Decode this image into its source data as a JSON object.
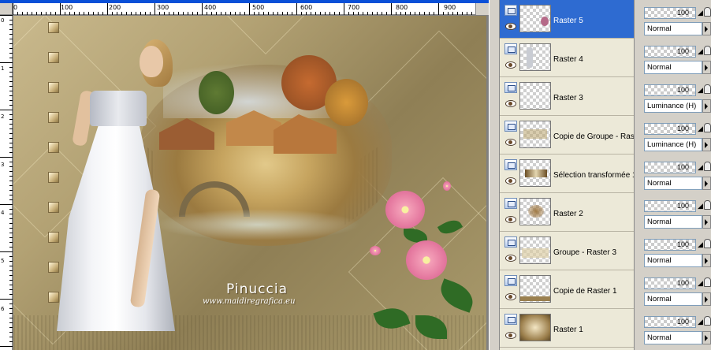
{
  "ruler": {
    "h_labels": [
      "0",
      "100",
      "200",
      "300",
      "400",
      "500",
      "600",
      "700",
      "800",
      "900"
    ],
    "v_labels": [
      "0",
      "1",
      "2",
      "3",
      "4",
      "5",
      "6"
    ]
  },
  "artwork": {
    "signature_name": "Pinuccia",
    "signature_url": "www.maidiregrafica.eu"
  },
  "layers": [
    {
      "name": "Raster 5",
      "selected": true,
      "opacity": "100",
      "blend": "Normal"
    },
    {
      "name": "Raster 4",
      "selected": false,
      "opacity": "100",
      "blend": "Normal"
    },
    {
      "name": "Raster 3",
      "selected": false,
      "opacity": "100",
      "blend": "Luminance (H)"
    },
    {
      "name": "Copie de Groupe - Raste",
      "selected": false,
      "opacity": "100",
      "blend": "Luminance (H)"
    },
    {
      "name": "Sélection transformée 1",
      "selected": false,
      "opacity": "100",
      "blend": "Normal"
    },
    {
      "name": "Raster 2",
      "selected": false,
      "opacity": "100",
      "blend": "Normal"
    },
    {
      "name": "Groupe - Raster 3",
      "selected": false,
      "opacity": "100",
      "blend": "Normal"
    },
    {
      "name": "Copie de Raster 1",
      "selected": false,
      "opacity": "100",
      "blend": "Normal"
    },
    {
      "name": "Raster 1",
      "selected": false,
      "opacity": "100",
      "blend": "Normal"
    }
  ],
  "colors": {
    "selection": "#2e6bd1",
    "panel_bg": "#ece9d8"
  }
}
